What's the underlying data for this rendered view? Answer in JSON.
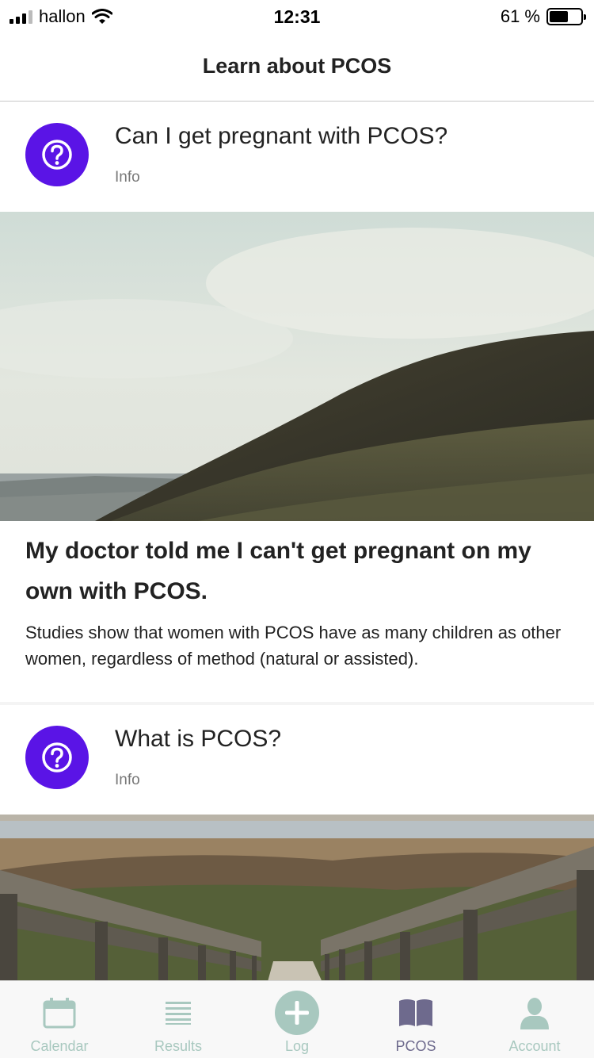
{
  "status_bar": {
    "carrier": "hallon",
    "time": "12:31",
    "battery_percent": "61 %",
    "battery_level": 0.61
  },
  "nav": {
    "title": "Learn about PCOS"
  },
  "cards": [
    {
      "title": "Can I get pregnant with PCOS?",
      "category": "Info",
      "icon": "question-icon",
      "image": "hillside-landscape",
      "headline": "My doctor told me I can't get pregnant on my own with PCOS.",
      "text": "Studies show that women with PCOS have as many children as other women, regardless of method (natural or assisted)."
    },
    {
      "title": "What is PCOS?",
      "category": "Info",
      "icon": "question-icon",
      "image": "wooden-boardwalk-marsh"
    }
  ],
  "tab_bar": {
    "tabs": [
      {
        "label": "Calendar",
        "icon": "calendar-icon"
      },
      {
        "label": "Results",
        "icon": "list-icon"
      },
      {
        "label": "Log",
        "icon": "plus-icon"
      },
      {
        "label": "PCOS",
        "icon": "book-icon",
        "active": true
      },
      {
        "label": "Account",
        "icon": "person-icon"
      }
    ]
  },
  "colors": {
    "accent_purple": "#5a14e6",
    "tab_inactive": "#a8c8bf",
    "tab_active": "#6e6a8d"
  }
}
